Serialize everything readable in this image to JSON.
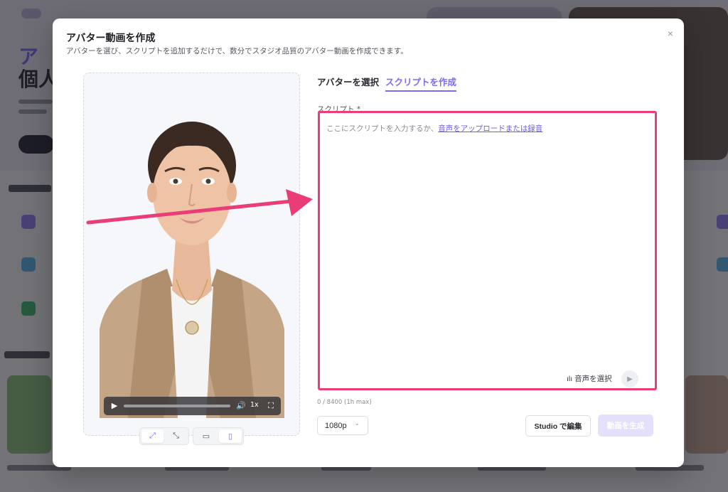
{
  "modal": {
    "title": "アバター動画を作成",
    "subtitle": "アバターを選び、スクリプトを追加するだけで、数分でスタジオ品質のアバター動画を作成できます。",
    "close_icon": "×"
  },
  "tabs": [
    {
      "label": "アバターを選択",
      "active": false
    },
    {
      "label": "スクリプトを作成",
      "active": true
    }
  ],
  "script": {
    "label": "スクリプト *",
    "placeholder": "ここにスクリプトを入力するか、",
    "upload_link": "音声をアップロードまたは録音",
    "voice_select": "音声を選択",
    "char_count": "0 / 8400 (1h max)"
  },
  "player": {
    "play_icon": "▶",
    "volume_icon": "🔊",
    "speed": "1x",
    "fullscreen_icon": "⛶"
  },
  "view_controls": {
    "expand_icon": "⤢",
    "shrink_icon": "⤡",
    "landscape_icon": "▭",
    "portrait_icon": "▯"
  },
  "footer": {
    "resolution": "1080p",
    "chevron": "⌄",
    "studio_button": "Studio で編集",
    "generate_button": "動画を生成"
  },
  "colors": {
    "accent": "#7b6cf0",
    "highlight": "#ea3d78"
  }
}
